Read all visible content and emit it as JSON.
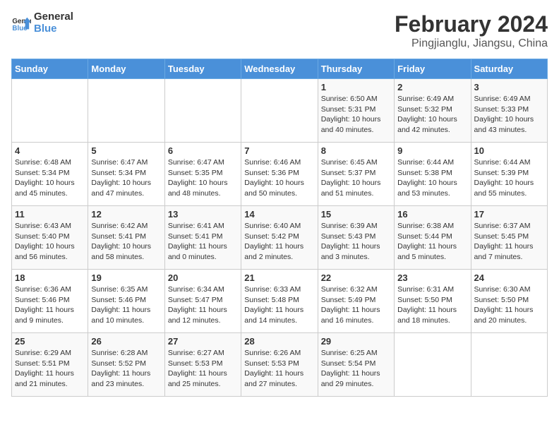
{
  "logo": {
    "line1": "General",
    "line2": "Blue"
  },
  "title": "February 2024",
  "subtitle": "Pingjianglu, Jiangsu, China",
  "header": {
    "days": [
      "Sunday",
      "Monday",
      "Tuesday",
      "Wednesday",
      "Thursday",
      "Friday",
      "Saturday"
    ]
  },
  "weeks": [
    {
      "cells": [
        {
          "day": "",
          "info": ""
        },
        {
          "day": "",
          "info": ""
        },
        {
          "day": "",
          "info": ""
        },
        {
          "day": "",
          "info": ""
        },
        {
          "day": "1",
          "info": "Sunrise: 6:50 AM\nSunset: 5:31 PM\nDaylight: 10 hours\nand 40 minutes."
        },
        {
          "day": "2",
          "info": "Sunrise: 6:49 AM\nSunset: 5:32 PM\nDaylight: 10 hours\nand 42 minutes."
        },
        {
          "day": "3",
          "info": "Sunrise: 6:49 AM\nSunset: 5:33 PM\nDaylight: 10 hours\nand 43 minutes."
        }
      ]
    },
    {
      "cells": [
        {
          "day": "4",
          "info": "Sunrise: 6:48 AM\nSunset: 5:34 PM\nDaylight: 10 hours\nand 45 minutes."
        },
        {
          "day": "5",
          "info": "Sunrise: 6:47 AM\nSunset: 5:34 PM\nDaylight: 10 hours\nand 47 minutes."
        },
        {
          "day": "6",
          "info": "Sunrise: 6:47 AM\nSunset: 5:35 PM\nDaylight: 10 hours\nand 48 minutes."
        },
        {
          "day": "7",
          "info": "Sunrise: 6:46 AM\nSunset: 5:36 PM\nDaylight: 10 hours\nand 50 minutes."
        },
        {
          "day": "8",
          "info": "Sunrise: 6:45 AM\nSunset: 5:37 PM\nDaylight: 10 hours\nand 51 minutes."
        },
        {
          "day": "9",
          "info": "Sunrise: 6:44 AM\nSunset: 5:38 PM\nDaylight: 10 hours\nand 53 minutes."
        },
        {
          "day": "10",
          "info": "Sunrise: 6:44 AM\nSunset: 5:39 PM\nDaylight: 10 hours\nand 55 minutes."
        }
      ]
    },
    {
      "cells": [
        {
          "day": "11",
          "info": "Sunrise: 6:43 AM\nSunset: 5:40 PM\nDaylight: 10 hours\nand 56 minutes."
        },
        {
          "day": "12",
          "info": "Sunrise: 6:42 AM\nSunset: 5:41 PM\nDaylight: 10 hours\nand 58 minutes."
        },
        {
          "day": "13",
          "info": "Sunrise: 6:41 AM\nSunset: 5:41 PM\nDaylight: 11 hours\nand 0 minutes."
        },
        {
          "day": "14",
          "info": "Sunrise: 6:40 AM\nSunset: 5:42 PM\nDaylight: 11 hours\nand 2 minutes."
        },
        {
          "day": "15",
          "info": "Sunrise: 6:39 AM\nSunset: 5:43 PM\nDaylight: 11 hours\nand 3 minutes."
        },
        {
          "day": "16",
          "info": "Sunrise: 6:38 AM\nSunset: 5:44 PM\nDaylight: 11 hours\nand 5 minutes."
        },
        {
          "day": "17",
          "info": "Sunrise: 6:37 AM\nSunset: 5:45 PM\nDaylight: 11 hours\nand 7 minutes."
        }
      ]
    },
    {
      "cells": [
        {
          "day": "18",
          "info": "Sunrise: 6:36 AM\nSunset: 5:46 PM\nDaylight: 11 hours\nand 9 minutes."
        },
        {
          "day": "19",
          "info": "Sunrise: 6:35 AM\nSunset: 5:46 PM\nDaylight: 11 hours\nand 10 minutes."
        },
        {
          "day": "20",
          "info": "Sunrise: 6:34 AM\nSunset: 5:47 PM\nDaylight: 11 hours\nand 12 minutes."
        },
        {
          "day": "21",
          "info": "Sunrise: 6:33 AM\nSunset: 5:48 PM\nDaylight: 11 hours\nand 14 minutes."
        },
        {
          "day": "22",
          "info": "Sunrise: 6:32 AM\nSunset: 5:49 PM\nDaylight: 11 hours\nand 16 minutes."
        },
        {
          "day": "23",
          "info": "Sunrise: 6:31 AM\nSunset: 5:50 PM\nDaylight: 11 hours\nand 18 minutes."
        },
        {
          "day": "24",
          "info": "Sunrise: 6:30 AM\nSunset: 5:50 PM\nDaylight: 11 hours\nand 20 minutes."
        }
      ]
    },
    {
      "cells": [
        {
          "day": "25",
          "info": "Sunrise: 6:29 AM\nSunset: 5:51 PM\nDaylight: 11 hours\nand 21 minutes."
        },
        {
          "day": "26",
          "info": "Sunrise: 6:28 AM\nSunset: 5:52 PM\nDaylight: 11 hours\nand 23 minutes."
        },
        {
          "day": "27",
          "info": "Sunrise: 6:27 AM\nSunset: 5:53 PM\nDaylight: 11 hours\nand 25 minutes."
        },
        {
          "day": "28",
          "info": "Sunrise: 6:26 AM\nSunset: 5:53 PM\nDaylight: 11 hours\nand 27 minutes."
        },
        {
          "day": "29",
          "info": "Sunrise: 6:25 AM\nSunset: 5:54 PM\nDaylight: 11 hours\nand 29 minutes."
        },
        {
          "day": "",
          "info": ""
        },
        {
          "day": "",
          "info": ""
        }
      ]
    }
  ]
}
